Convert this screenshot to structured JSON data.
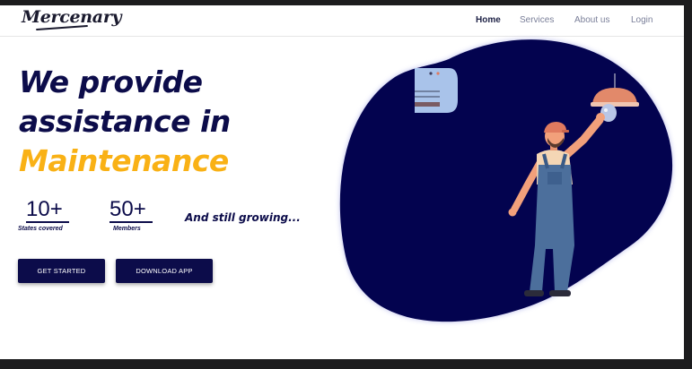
{
  "brand": {
    "logo_text": "Mercenary"
  },
  "nav": {
    "items": [
      {
        "label": "Home",
        "active": true
      },
      {
        "label": "Services",
        "active": false
      },
      {
        "label": "About us",
        "active": false
      },
      {
        "label": "Login",
        "active": false
      }
    ]
  },
  "hero": {
    "line1": "We provide",
    "line2": "assistance in",
    "line3": "Maintenance"
  },
  "stats": [
    {
      "value": "10+",
      "label": "States covered"
    },
    {
      "value": "50+",
      "label": "Members"
    }
  ],
  "tagline": "And still growing...",
  "buttons": {
    "get_started": "GET STARTED",
    "download_app": "DOWNLOAD APP"
  },
  "colors": {
    "navy": "#0c0c4a",
    "accent": "#f9b115",
    "blob": "#03034f"
  }
}
